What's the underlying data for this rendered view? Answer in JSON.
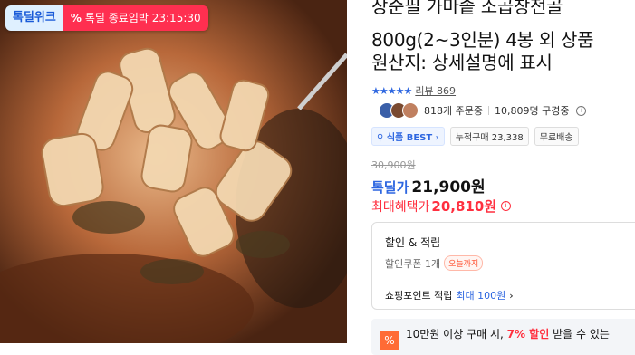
{
  "badge": {
    "logo": "톡딜위크",
    "timer_icon": "%",
    "timer_text": "톡딜 종료임박 23:15:30"
  },
  "product": {
    "title_lines": [
      "장순필 가마솥 소곱창전골",
      "800g(2~3인분) 4봉 외 상품",
      "원산지: 상세설명에 표시"
    ],
    "stars": "★★★★★",
    "review_text": "리뷰 869",
    "orders_text": "818개 주문중",
    "watchers_text": "10,809명 구경중",
    "tags": [
      {
        "label": "식품 BEST ›",
        "icon": "pin-icon"
      },
      {
        "label": "누적구매 23,338"
      },
      {
        "label": "무료배송"
      }
    ],
    "original_price": "30,900원",
    "price_label": "톡딜가",
    "price": "21,900원",
    "max_label": "최대혜택가",
    "max_price": "20,810원"
  },
  "benefits": {
    "title": "할인 & 적립",
    "coupon": "할인쿠폰 1개",
    "coupon_pill": "오늘까지",
    "point_label": "쇼핑포인트 적립",
    "point_value": "최대 100원",
    "chevron": "›"
  },
  "promo": {
    "prefix": "10만원 이상 구매 시, ",
    "highlight": "7% 할인",
    "suffix": " 받을 수 있는"
  },
  "colors": {
    "accent": "#2d66e0",
    "red": "#ff2f3f",
    "badge_red": "#ff2f50"
  }
}
